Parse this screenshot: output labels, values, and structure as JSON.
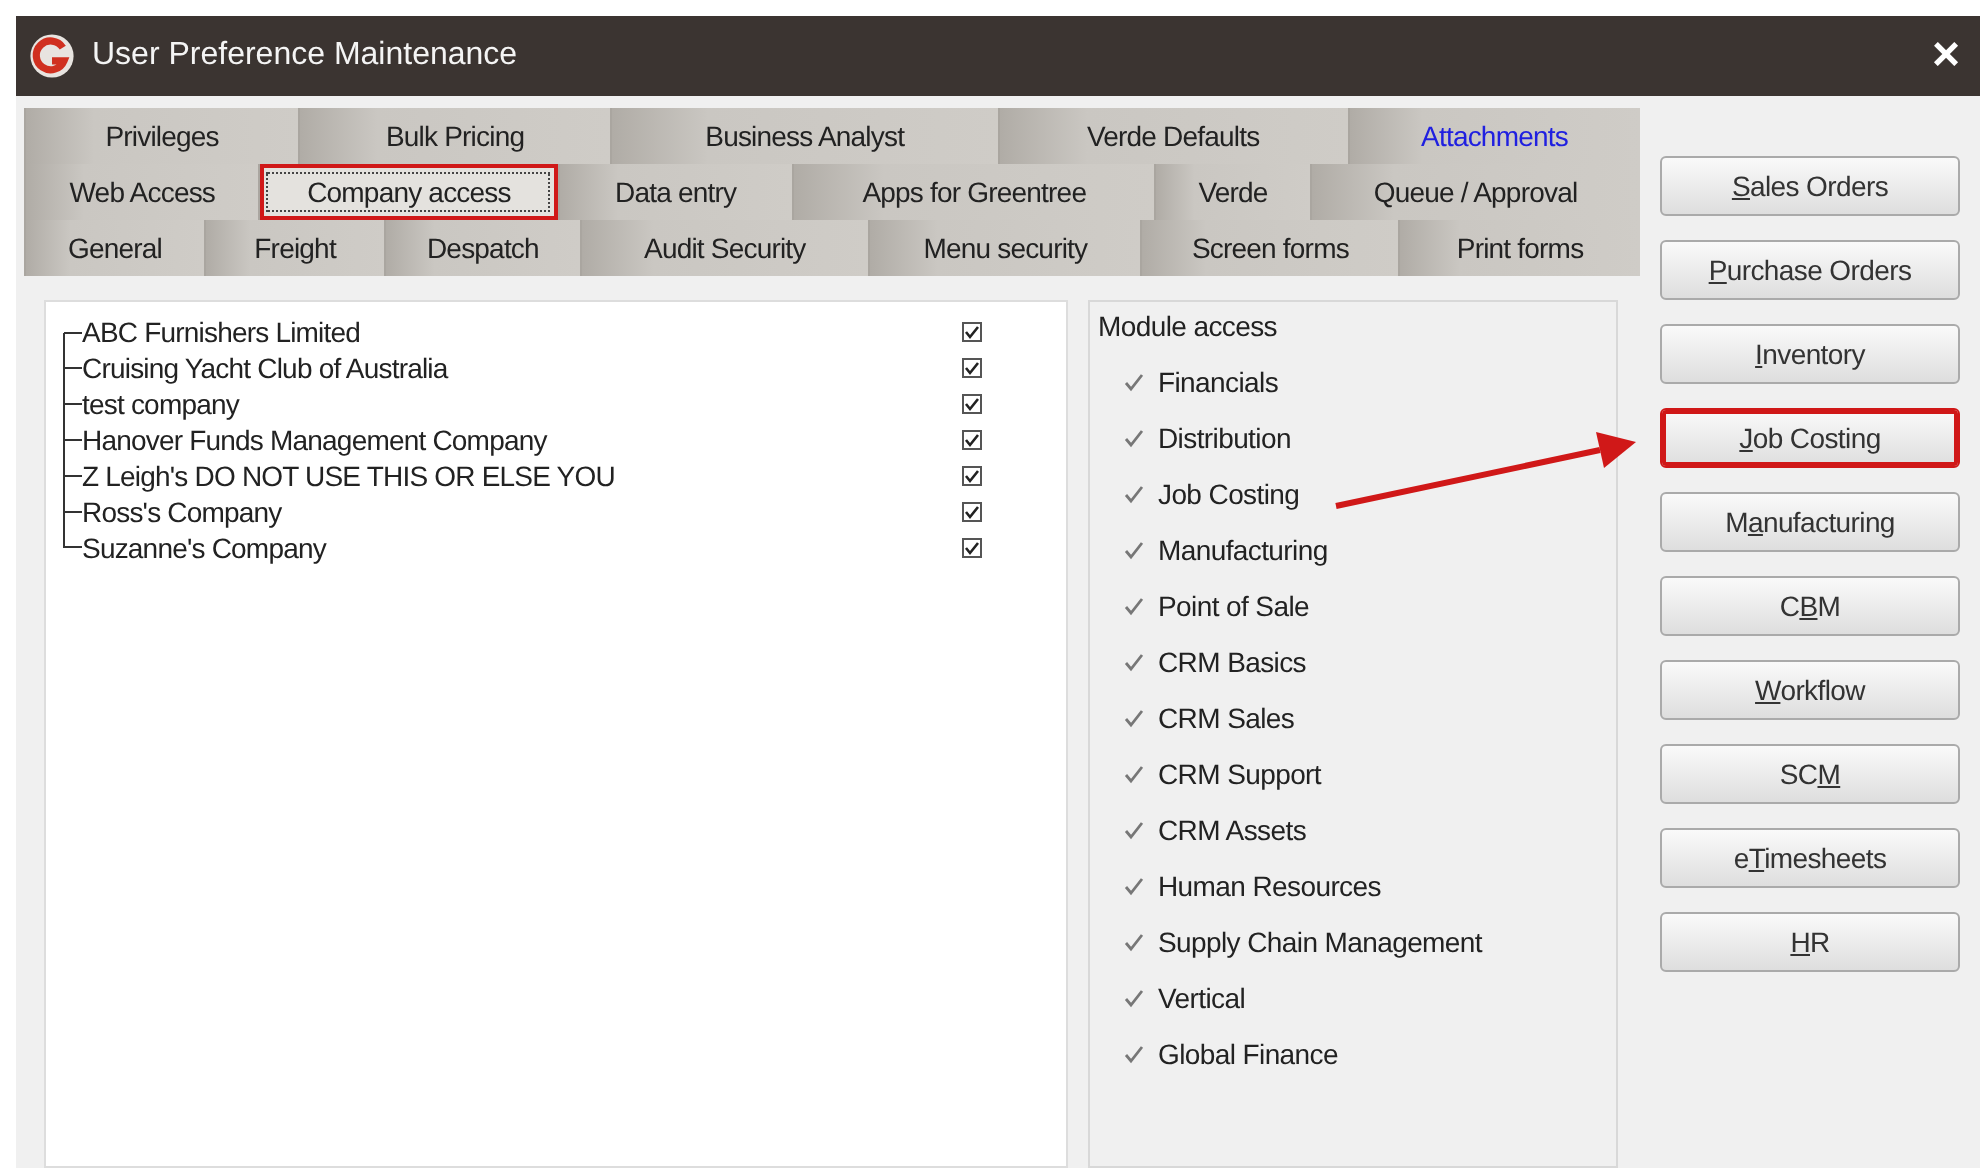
{
  "window": {
    "title": "User Preference Maintenance",
    "close": "×"
  },
  "tab_rows": [
    [
      {
        "label": "Privileges",
        "selected": false,
        "highlighted": false,
        "marked": false
      },
      {
        "label": "Bulk Pricing",
        "selected": false,
        "highlighted": false,
        "marked": false
      },
      {
        "label": "Business Analyst",
        "selected": false,
        "highlighted": false,
        "marked": false
      },
      {
        "label": "Verde Defaults",
        "selected": false,
        "highlighted": false,
        "marked": false
      },
      {
        "label": "Attachments",
        "selected": false,
        "highlighted": true,
        "marked": false
      }
    ],
    [
      {
        "label": "Web Access",
        "selected": false,
        "highlighted": false,
        "marked": false
      },
      {
        "label": "Company access",
        "selected": true,
        "highlighted": false,
        "marked": true
      },
      {
        "label": "Data entry",
        "selected": false,
        "highlighted": false,
        "marked": false
      },
      {
        "label": "Apps for Greentree",
        "selected": false,
        "highlighted": false,
        "marked": false
      },
      {
        "label": "Verde",
        "selected": false,
        "highlighted": false,
        "marked": false
      },
      {
        "label": "Queue / Approval",
        "selected": false,
        "highlighted": false,
        "marked": false
      }
    ],
    [
      {
        "label": "General",
        "selected": false,
        "highlighted": false,
        "marked": false
      },
      {
        "label": "Freight",
        "selected": false,
        "highlighted": false,
        "marked": false
      },
      {
        "label": "Despatch",
        "selected": false,
        "highlighted": false,
        "marked": false
      },
      {
        "label": "Audit Security",
        "selected": false,
        "highlighted": false,
        "marked": false
      },
      {
        "label": "Menu security",
        "selected": false,
        "highlighted": false,
        "marked": false
      },
      {
        "label": "Screen forms",
        "selected": false,
        "highlighted": false,
        "marked": false
      },
      {
        "label": "Print forms",
        "selected": false,
        "highlighted": false,
        "marked": false
      }
    ]
  ],
  "companies": [
    {
      "name": "ABC Furnishers Limited",
      "checked": true
    },
    {
      "name": "Cruising Yacht Club of Australia",
      "checked": true
    },
    {
      "name": "test company",
      "checked": true
    },
    {
      "name": "Hanover Funds Management Company",
      "checked": true
    },
    {
      "name": "Z Leigh's DO NOT USE THIS OR ELSE YOU",
      "checked": true
    },
    {
      "name": "Ross's Company",
      "checked": true
    },
    {
      "name": "Suzanne's Company",
      "checked": true
    }
  ],
  "module_access": {
    "title": "Module access",
    "items": [
      {
        "label": "Financials",
        "checked": true
      },
      {
        "label": "Distribution",
        "checked": true
      },
      {
        "label": "Job Costing",
        "checked": true,
        "arrow_from": true
      },
      {
        "label": "Manufacturing",
        "checked": true
      },
      {
        "label": "Point of Sale",
        "checked": true
      },
      {
        "label": "CRM Basics",
        "checked": true
      },
      {
        "label": "CRM Sales",
        "checked": true
      },
      {
        "label": "CRM Support",
        "checked": true
      },
      {
        "label": "CRM Assets",
        "checked": true
      },
      {
        "label": "Human Resources",
        "checked": true
      },
      {
        "label": "Supply Chain Management",
        "checked": true
      },
      {
        "label": "Vertical",
        "checked": true
      },
      {
        "label": "Global Finance",
        "checked": true
      }
    ]
  },
  "buttons": [
    {
      "key": "S",
      "after": "ales Orders",
      "marked": false
    },
    {
      "key": "P",
      "after": "urchase Orders",
      "marked": false
    },
    {
      "key": "I",
      "after": "nventory",
      "marked": false
    },
    {
      "key": "J",
      "after": "ob Costing",
      "marked": true
    },
    {
      "before": "M",
      "key": "a",
      "after": "nufacturing",
      "marked": false
    },
    {
      "before": "C",
      "key": "B",
      "after": "M",
      "marked": false
    },
    {
      "key": "W",
      "after": "orkflow",
      "marked": false
    },
    {
      "before": "SC",
      "key": "M",
      "marked": false
    },
    {
      "before": "e",
      "key": "T",
      "after": "imesheets",
      "marked": false
    },
    {
      "key": "H",
      "after": "R",
      "marked": false
    }
  ]
}
